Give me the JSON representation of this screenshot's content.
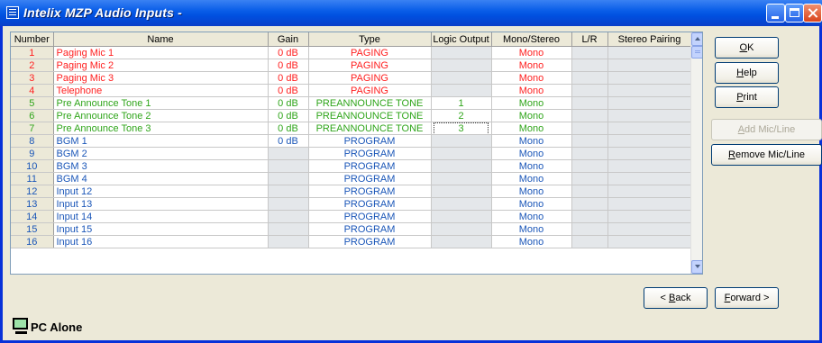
{
  "window": {
    "title": "Intelix MZP Audio Inputs -"
  },
  "columns": [
    "Number",
    "Name",
    "Gain",
    "Type",
    "Logic Output",
    "Mono/Stereo",
    "L/R",
    "Stereo Pairing"
  ],
  "rows": [
    {
      "number": "1",
      "name": "Paging Mic 1",
      "gain": "0 dB",
      "type": "PAGING",
      "logic": "",
      "mono": "Mono",
      "lr": "",
      "pairing": "",
      "color": "red"
    },
    {
      "number": "2",
      "name": "Paging Mic 2",
      "gain": "0 dB",
      "type": "PAGING",
      "logic": "",
      "mono": "Mono",
      "lr": "",
      "pairing": "",
      "color": "red"
    },
    {
      "number": "3",
      "name": "Paging Mic 3",
      "gain": "0 dB",
      "type": "PAGING",
      "logic": "",
      "mono": "Mono",
      "lr": "",
      "pairing": "",
      "color": "red"
    },
    {
      "number": "4",
      "name": "Telephone",
      "gain": "0 dB",
      "type": "PAGING",
      "logic": "",
      "mono": "Mono",
      "lr": "",
      "pairing": "",
      "color": "red"
    },
    {
      "number": "5",
      "name": "Pre Announce Tone 1",
      "gain": "0 dB",
      "type": "PREANNOUNCE TONE",
      "logic": "1",
      "mono": "Mono",
      "lr": "",
      "pairing": "",
      "color": "green"
    },
    {
      "number": "6",
      "name": "Pre Announce Tone 2",
      "gain": "0 dB",
      "type": "PREANNOUNCE TONE",
      "logic": "2",
      "mono": "Mono",
      "lr": "",
      "pairing": "",
      "color": "green"
    },
    {
      "number": "7",
      "name": "Pre Announce Tone 3",
      "gain": "0 dB",
      "type": "PREANNOUNCE TONE",
      "logic": "3",
      "mono": "Mono",
      "lr": "",
      "pairing": "",
      "color": "green"
    },
    {
      "number": "8",
      "name": "BGM 1",
      "gain": "0 dB",
      "type": "PROGRAM",
      "logic": "",
      "mono": "Mono",
      "lr": "",
      "pairing": "",
      "color": "blue"
    },
    {
      "number": "9",
      "name": "BGM 2",
      "gain": "",
      "type": "PROGRAM",
      "logic": "",
      "mono": "Mono",
      "lr": "",
      "pairing": "",
      "color": "blue"
    },
    {
      "number": "10",
      "name": "BGM 3",
      "gain": "",
      "type": "PROGRAM",
      "logic": "",
      "mono": "Mono",
      "lr": "",
      "pairing": "",
      "color": "blue"
    },
    {
      "number": "11",
      "name": "BGM 4",
      "gain": "",
      "type": "PROGRAM",
      "logic": "",
      "mono": "Mono",
      "lr": "",
      "pairing": "",
      "color": "blue"
    },
    {
      "number": "12",
      "name": "Input 12",
      "gain": "",
      "type": "PROGRAM",
      "logic": "",
      "mono": "Mono",
      "lr": "",
      "pairing": "",
      "color": "blue"
    },
    {
      "number": "13",
      "name": "Input 13",
      "gain": "",
      "type": "PROGRAM",
      "logic": "",
      "mono": "Mono",
      "lr": "",
      "pairing": "",
      "color": "blue"
    },
    {
      "number": "14",
      "name": "Input 14",
      "gain": "",
      "type": "PROGRAM",
      "logic": "",
      "mono": "Mono",
      "lr": "",
      "pairing": "",
      "color": "blue"
    },
    {
      "number": "15",
      "name": "Input 15",
      "gain": "",
      "type": "PROGRAM",
      "logic": "",
      "mono": "Mono",
      "lr": "",
      "pairing": "",
      "color": "blue"
    },
    {
      "number": "16",
      "name": "Input 16",
      "gain": "",
      "type": "PROGRAM",
      "logic": "",
      "mono": "Mono",
      "lr": "",
      "pairing": "",
      "color": "blue"
    }
  ],
  "buttons": {
    "ok": {
      "pre": "",
      "ul": "O",
      "post": "K"
    },
    "help": {
      "pre": "",
      "ul": "H",
      "post": "elp"
    },
    "print": {
      "pre": "",
      "ul": "P",
      "post": "rint"
    },
    "add": {
      "pre": "",
      "ul": "A",
      "post": "dd Mic/Line"
    },
    "remove": {
      "pre": "",
      "ul": "R",
      "post": "emove Mic/Line"
    },
    "back": {
      "pre": "< ",
      "ul": "B",
      "post": "ack"
    },
    "forward": {
      "pre": "",
      "ul": "F",
      "post": "orward >"
    }
  },
  "status": {
    "text": "PC Alone"
  },
  "colors": {
    "paging": "#ff2020",
    "preannounce": "#2fa51a",
    "program": "#1a56b8",
    "titlebar": "#0a5ee8"
  }
}
